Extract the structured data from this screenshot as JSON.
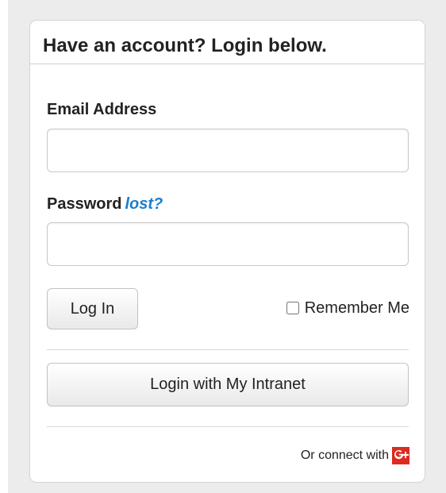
{
  "login_card": {
    "title": "Have an account? Login below.",
    "email_label": "Email Address",
    "email_value": "",
    "email_placeholder": "",
    "password_label": "Password",
    "lost_link": "lost?",
    "password_value": "",
    "password_placeholder": "",
    "login_button": "Log In",
    "remember_me": "Remember Me",
    "intranet_button": "Login with My Intranet",
    "connect_with": "Or connect with"
  },
  "icons": {
    "google_plus": "google-plus-icon"
  },
  "colors": {
    "background": "#ececec",
    "card": "#ffffff",
    "link": "#1b7fcc",
    "google_plus": "#dd2b20"
  }
}
